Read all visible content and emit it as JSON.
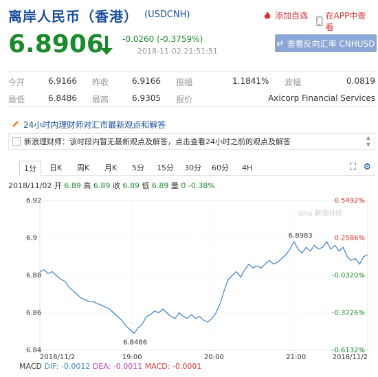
{
  "header": {
    "title": "离岸人民币（香港）",
    "code": "(USDCNH)",
    "fav_label": "添加自选",
    "app_label": "在APP中查看"
  },
  "quote": {
    "price": "6.8906",
    "change": "-0.0260 (-0.3759%)",
    "time": "2018-11-02 21:51:51",
    "reverse_button": "查看反向汇率 CNHUSD"
  },
  "stats": {
    "open_label": "今开",
    "open": "6.9166",
    "prev_label": "昨收",
    "prev": "6.9166",
    "amp_label": "振幅",
    "amp": "1.1841%",
    "wave_label": "波幅",
    "wave": "0.0819",
    "low_label": "最低",
    "low": "6.8486",
    "high_label": "最高",
    "high": "6.9305",
    "quoter_label": "报价",
    "quoter": "Axicorp Financial Services"
  },
  "news": {
    "title": "24小时内理财师对汇市最新观点和解答",
    "text": "新浪理财师：该时段内暂无最新观点及解答，点击查看24小时之前的观点及解答"
  },
  "tabs": [
    "1分",
    "日K",
    "周K",
    "月K",
    "5分",
    "15分",
    "30分",
    "60分",
    "4H"
  ],
  "ohlc_line": {
    "date": "2018/11/02",
    "open_l": "开",
    "open": "6.89",
    "high_l": "高",
    "high": "6.89",
    "close_l": "收",
    "close": "6.89",
    "low_l": "低",
    "low": "6.89",
    "vol_l": "量",
    "vol": "0",
    "pct": "-0.38%"
  },
  "macd": {
    "label": "MACD",
    "dif": "DIF: -0.0012",
    "dea": "DEA: -0.0011",
    "macd": "MACD: -0.0001"
  },
  "chart_data": {
    "type": "line",
    "ylim": [
      6.84,
      6.92
    ],
    "yticks": [
      "6.92",
      "6.9",
      "6.88",
      "6.86",
      "6.84"
    ],
    "pct_ticks": [
      "0.5492%",
      "0.2586%",
      "-0.0320%",
      "-0.3226%",
      "-0.6132%"
    ],
    "xticks": [
      "2018/11/2",
      "19:00",
      "20:00",
      "21:00",
      "2018/11/2"
    ],
    "watermark": "sina 新浪财经",
    "annot_high": "6.8983",
    "annot_low": "6.8486",
    "colors": {
      "line": "#3b7fd0",
      "up": "#e03030",
      "down": "#1a8a2a"
    },
    "points": [
      [
        0,
        6.882
      ],
      [
        2,
        6.883
      ],
      [
        4,
        6.881
      ],
      [
        6,
        6.882
      ],
      [
        8,
        6.88
      ],
      [
        10,
        6.878
      ],
      [
        12,
        6.877
      ],
      [
        14,
        6.874
      ],
      [
        16,
        6.872
      ],
      [
        18,
        6.87
      ],
      [
        20,
        6.868
      ],
      [
        22,
        6.867
      ],
      [
        24,
        6.866
      ],
      [
        26,
        6.866
      ],
      [
        28,
        6.865
      ],
      [
        30,
        6.864
      ],
      [
        32,
        6.863
      ],
      [
        34,
        6.862
      ],
      [
        36,
        6.86
      ],
      [
        38,
        6.858
      ],
      [
        40,
        6.856
      ],
      [
        42,
        6.853
      ],
      [
        44,
        6.851
      ],
      [
        46,
        6.849
      ],
      [
        48,
        6.852
      ],
      [
        50,
        6.854
      ],
      [
        52,
        6.858
      ],
      [
        54,
        6.859
      ],
      [
        56,
        6.861
      ],
      [
        58,
        6.86
      ],
      [
        60,
        6.862
      ],
      [
        62,
        6.86
      ],
      [
        64,
        6.858
      ],
      [
        66,
        6.857
      ],
      [
        68,
        6.86
      ],
      [
        70,
        6.858
      ],
      [
        72,
        6.857
      ],
      [
        74,
        6.859
      ],
      [
        76,
        6.857
      ],
      [
        78,
        6.858
      ],
      [
        80,
        6.856
      ],
      [
        82,
        6.855
      ],
      [
        84,
        6.857
      ],
      [
        86,
        6.86
      ],
      [
        88,
        6.865
      ],
      [
        90,
        6.872
      ],
      [
        92,
        6.878
      ],
      [
        94,
        6.88
      ],
      [
        96,
        6.882
      ],
      [
        98,
        6.879
      ],
      [
        100,
        6.883
      ],
      [
        102,
        6.886
      ],
      [
        104,
        6.884
      ],
      [
        106,
        6.885
      ],
      [
        108,
        6.884
      ],
      [
        110,
        6.886
      ],
      [
        112,
        6.888
      ],
      [
        114,
        6.886
      ],
      [
        116,
        6.887
      ],
      [
        118,
        6.889
      ],
      [
        120,
        6.891
      ],
      [
        122,
        6.894
      ],
      [
        124,
        6.898
      ],
      [
        126,
        6.894
      ],
      [
        128,
        6.892
      ],
      [
        130,
        6.895
      ],
      [
        132,
        6.893
      ],
      [
        134,
        6.896
      ],
      [
        136,
        6.894
      ],
      [
        138,
        6.895
      ],
      [
        140,
        6.898
      ],
      [
        142,
        6.894
      ],
      [
        144,
        6.896
      ],
      [
        146,
        6.893
      ],
      [
        148,
        6.895
      ],
      [
        150,
        6.89
      ],
      [
        152,
        6.888
      ],
      [
        154,
        6.889
      ],
      [
        156,
        6.886
      ],
      [
        158,
        6.89
      ],
      [
        160,
        6.891
      ]
    ],
    "x_range": [
      0,
      160
    ],
    "xtick_pos": [
      0,
      45,
      85,
      125,
      160
    ]
  }
}
